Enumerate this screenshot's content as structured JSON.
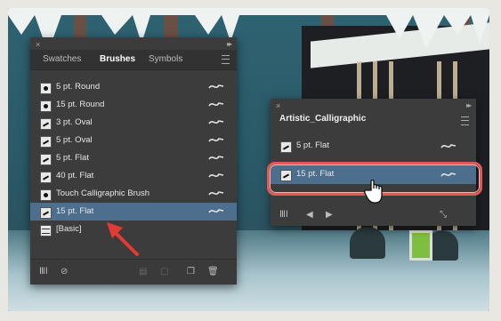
{
  "brushes_panel": {
    "close": "×",
    "collapse": "▸▸",
    "tabs": [
      {
        "label": "Swatches",
        "active": false
      },
      {
        "label": "Brushes",
        "active": true
      },
      {
        "label": "Symbols",
        "active": false
      }
    ],
    "items": [
      {
        "label": "5 pt. Round",
        "icon": "round-brush-icon"
      },
      {
        "label": "15 pt. Round",
        "icon": "round-brush-icon"
      },
      {
        "label": "3 pt. Oval",
        "icon": "oval-brush-icon"
      },
      {
        "label": "5 pt. Oval",
        "icon": "oval-brush-icon"
      },
      {
        "label": "5 pt. Flat",
        "icon": "flat-brush-icon"
      },
      {
        "label": "40 pt. Flat",
        "icon": "flat-brush-icon"
      },
      {
        "label": "Touch Calligraphic Brush",
        "icon": "round-brush-icon"
      },
      {
        "label": "15 pt. Flat",
        "icon": "flat-brush-icon",
        "selected": true
      },
      {
        "label": "[Basic]",
        "icon": "basic-brush-icon"
      }
    ],
    "bottom_icons": [
      "brush-libraries-icon",
      "remove-stroke-icon",
      "options-icon",
      "new-brush-icon",
      "delete-icon"
    ]
  },
  "calligraphic_panel": {
    "close": "×",
    "collapse": "▸▸",
    "title": "Artistic_Calligraphic",
    "items": [
      {
        "label": "5 pt. Flat"
      },
      {
        "label": "15 pt. Flat",
        "selected": true
      }
    ],
    "bottom_icons": [
      "library-menu-icon",
      "previous-library-icon",
      "next-library-icon",
      "add-to-brushes-icon"
    ]
  },
  "colors": {
    "panel_bg": "#3c3c3c",
    "selection": "#4d6f8d",
    "highlight": "#e05a57",
    "arrow": "#e23b35"
  }
}
